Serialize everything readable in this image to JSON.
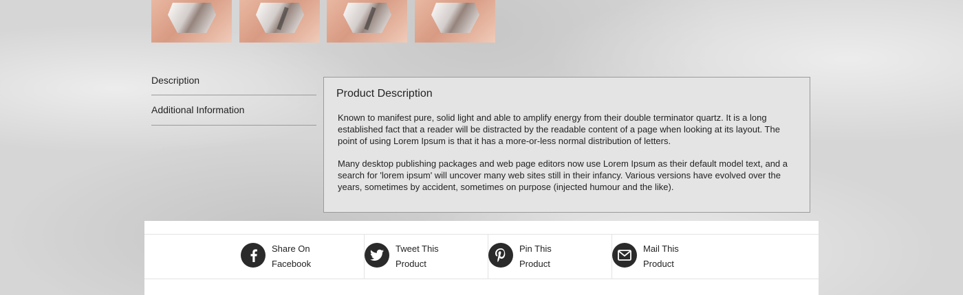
{
  "tabs": [
    {
      "label": "Description"
    },
    {
      "label": "Additional Information"
    }
  ],
  "panel": {
    "title": "Product Description",
    "paragraphs": [
      "Known to manifest pure, solid light and able to amplify energy from their double terminator quartz. It is a long established fact that a reader will be distracted by the readable content of a page when looking at its layout. The point of using Lorem Ipsum is that it has a more-or-less normal distribution of letters.",
      "Many desktop publishing packages and web page editors now use Lorem Ipsum as their default model text, and a search for 'lorem ipsum' will uncover many web sites still in their infancy. Various versions have evolved over the years, sometimes by accident, sometimes on purpose (injected humour and the like)."
    ]
  },
  "share": [
    {
      "line1": "Share On",
      "line2": "Facebook",
      "icon": "facebook-icon"
    },
    {
      "line1": "Tweet This",
      "line2": "Product",
      "icon": "twitter-icon"
    },
    {
      "line1": "Pin This",
      "line2": "Product",
      "icon": "pinterest-icon"
    },
    {
      "line1": "Mail This",
      "line2": "Product",
      "icon": "mail-icon"
    }
  ],
  "colors": {
    "background": "#d6d6d6",
    "panel": "#e4e4e4",
    "icon_circle": "#2a2a2a"
  }
}
